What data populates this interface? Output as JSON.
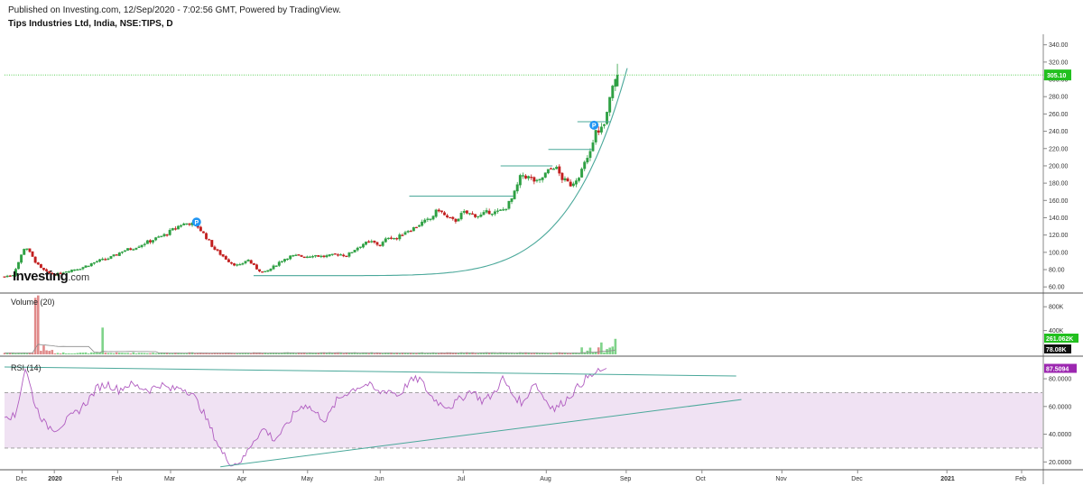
{
  "header": {
    "published": "Published on Investing.com, 12/Sep/2020 - 7:02:56 GMT, Powered by TradingView.",
    "symbol": "Tips Industries Ltd, India, NSE:TIPS, D"
  },
  "logo": {
    "brand": "Investing",
    "suffix": ".com"
  },
  "colors": {
    "up": "#2ea043",
    "down": "#c21f1f",
    "rsi": "#b05cc0",
    "trendline": "#4aa89a",
    "band": "#f0e2f3",
    "last_price": "#22c01f"
  },
  "chart_data": [
    {
      "type": "candlestick",
      "panel": "price",
      "ylim": [
        55,
        348
      ],
      "y_ticks": [
        "340.00",
        "320.00",
        "300.00",
        "280.00",
        "260.00",
        "240.00",
        "220.00",
        "200.00",
        "180.00",
        "160.00",
        "140.00",
        "120.00",
        "100.00",
        "80.00",
        "60.00"
      ],
      "y_tick_values": [
        340,
        320,
        300,
        280,
        260,
        240,
        220,
        200,
        180,
        160,
        140,
        120,
        100,
        80,
        60
      ],
      "last_price": {
        "label": "305.10",
        "value": 305.1
      },
      "x_labels": [
        "Dec",
        "2020",
        "Feb",
        "Mar",
        "Apr",
        "May",
        "Jun",
        "Jul",
        "Aug",
        "Sep",
        "Oct",
        "Nov",
        "Dec",
        "2021",
        "Feb"
      ],
      "x_label_days": [
        17,
        48,
        109,
        160,
        230,
        292,
        362,
        442,
        522,
        599,
        672,
        749,
        822,
        908,
        980
      ],
      "closes_sample": [
        [
          0,
          72
        ],
        [
          8,
          74
        ],
        [
          14,
          90
        ],
        [
          20,
          108
        ],
        [
          26,
          96
        ],
        [
          34,
          82
        ],
        [
          42,
          76
        ],
        [
          50,
          74
        ],
        [
          58,
          78
        ],
        [
          66,
          80
        ],
        [
          74,
          82
        ],
        [
          82,
          86
        ],
        [
          90,
          90
        ],
        [
          98,
          92
        ],
        [
          106,
          96
        ],
        [
          114,
          102
        ],
        [
          122,
          104
        ],
        [
          130,
          108
        ],
        [
          138,
          112
        ],
        [
          146,
          116
        ],
        [
          154,
          120
        ],
        [
          162,
          126
        ],
        [
          170,
          132
        ],
        [
          178,
          134
        ],
        [
          186,
          130
        ],
        [
          194,
          118
        ],
        [
          202,
          104
        ],
        [
          210,
          96
        ],
        [
          218,
          88
        ],
        [
          226,
          84
        ],
        [
          234,
          92
        ],
        [
          242,
          82
        ],
        [
          250,
          76
        ],
        [
          258,
          82
        ],
        [
          266,
          90
        ],
        [
          274,
          95
        ],
        [
          282,
          96
        ],
        [
          290,
          95
        ],
        [
          298,
          97
        ],
        [
          306,
          95
        ],
        [
          314,
          96
        ],
        [
          322,
          98
        ],
        [
          330,
          96
        ],
        [
          338,
          104
        ],
        [
          346,
          110
        ],
        [
          354,
          112
        ],
        [
          362,
          108
        ],
        [
          370,
          118
        ],
        [
          378,
          116
        ],
        [
          386,
          124
        ],
        [
          394,
          128
        ],
        [
          402,
          134
        ],
        [
          410,
          138
        ],
        [
          418,
          150
        ],
        [
          426,
          140
        ],
        [
          434,
          136
        ],
        [
          442,
          146
        ],
        [
          450,
          144
        ],
        [
          458,
          142
        ],
        [
          466,
          147
        ],
        [
          474,
          146
        ],
        [
          482,
          150
        ],
        [
          490,
          164
        ],
        [
          498,
          190
        ],
        [
          506,
          186
        ],
        [
          514,
          180
        ],
        [
          522,
          192
        ],
        [
          530,
          200
        ],
        [
          538,
          184
        ],
        [
          546,
          178
        ],
        [
          554,
          190
        ],
        [
          562,
          208
        ],
        [
          570,
          240
        ],
        [
          578,
          246
        ],
        [
          586,
          292
        ],
        [
          589,
          305
        ]
      ],
      "plateaus": [
        {
          "from_day": 390,
          "to_day": 490,
          "value": 165
        },
        {
          "from_day": 478,
          "to_day": 528,
          "value": 200
        },
        {
          "from_day": 524,
          "to_day": 566,
          "value": 219
        },
        {
          "from_day": 552,
          "to_day": 584,
          "value": 251
        }
      ],
      "p_markers": [
        {
          "day": 185,
          "value": 135
        },
        {
          "day": 568,
          "value": 247
        }
      ]
    },
    {
      "type": "bar",
      "panel": "volume",
      "title": "Volume (20)",
      "y_ticks": [
        "800K",
        "400K"
      ],
      "y_tick_values": [
        800000,
        400000
      ],
      "ylim": [
        0,
        1000000
      ],
      "labels": [
        {
          "label": "261.062K",
          "value": 261062
        },
        {
          "label": "78.08K",
          "value": 78080
        }
      ]
    },
    {
      "type": "line",
      "panel": "rsi",
      "title": "RSI (14)",
      "y_ticks": [
        "80.0000",
        "60.0000",
        "40.0000",
        "20.0000"
      ],
      "y_tick_values": [
        80,
        60,
        40,
        20
      ],
      "ylim": [
        15,
        95
      ],
      "band": [
        30,
        70
      ],
      "last": {
        "label": "87.5094",
        "value": 87.5094
      },
      "values": [
        [
          0,
          55
        ],
        [
          10,
          52
        ],
        [
          20,
          88
        ],
        [
          30,
          60
        ],
        [
          40,
          46
        ],
        [
          50,
          44
        ],
        [
          60,
          50
        ],
        [
          70,
          56
        ],
        [
          80,
          64
        ],
        [
          90,
          74
        ],
        [
          100,
          76
        ],
        [
          110,
          72
        ],
        [
          120,
          76
        ],
        [
          130,
          74
        ],
        [
          140,
          72
        ],
        [
          150,
          76
        ],
        [
          160,
          72
        ],
        [
          170,
          74
        ],
        [
          180,
          70
        ],
        [
          190,
          58
        ],
        [
          200,
          42
        ],
        [
          210,
          26
        ],
        [
          220,
          18
        ],
        [
          230,
          22
        ],
        [
          240,
          36
        ],
        [
          250,
          44
        ],
        [
          260,
          36
        ],
        [
          270,
          44
        ],
        [
          280,
          56
        ],
        [
          290,
          62
        ],
        [
          300,
          55
        ],
        [
          310,
          50
        ],
        [
          320,
          64
        ],
        [
          330,
          70
        ],
        [
          340,
          74
        ],
        [
          350,
          76
        ],
        [
          360,
          70
        ],
        [
          370,
          72
        ],
        [
          380,
          68
        ],
        [
          390,
          78
        ],
        [
          400,
          80
        ],
        [
          410,
          68
        ],
        [
          420,
          62
        ],
        [
          430,
          60
        ],
        [
          440,
          66
        ],
        [
          450,
          72
        ],
        [
          460,
          64
        ],
        [
          470,
          68
        ],
        [
          480,
          80
        ],
        [
          490,
          68
        ],
        [
          500,
          62
        ],
        [
          510,
          78
        ],
        [
          520,
          66
        ],
        [
          530,
          58
        ],
        [
          540,
          64
        ],
        [
          550,
          72
        ],
        [
          560,
          80
        ],
        [
          570,
          84
        ],
        [
          580,
          87.5
        ]
      ]
    }
  ]
}
